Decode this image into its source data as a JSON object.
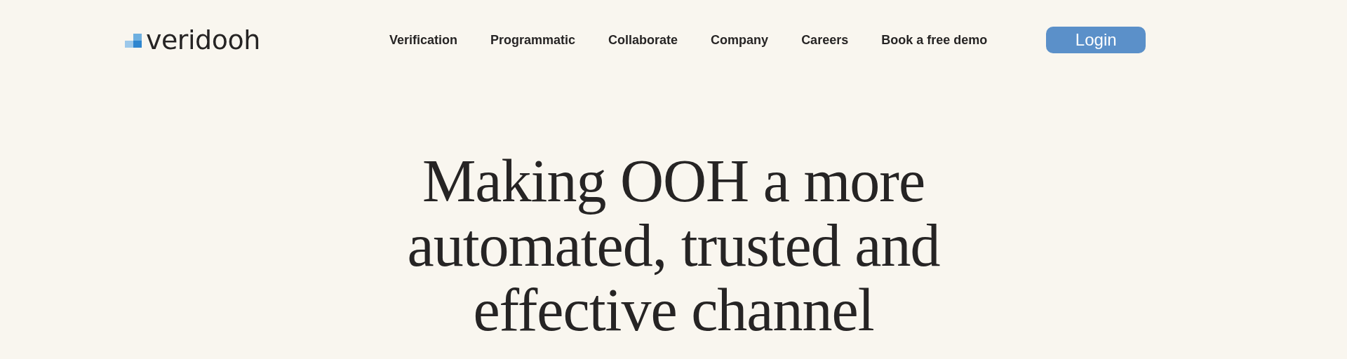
{
  "header": {
    "logo": "veridooh",
    "nav": [
      "Verification",
      "Programmatic",
      "Collaborate",
      "Company",
      "Careers",
      "Book a free demo"
    ],
    "login": "Login"
  },
  "hero": {
    "heading": "Making OOH a more automated, trusted and effective channel"
  }
}
